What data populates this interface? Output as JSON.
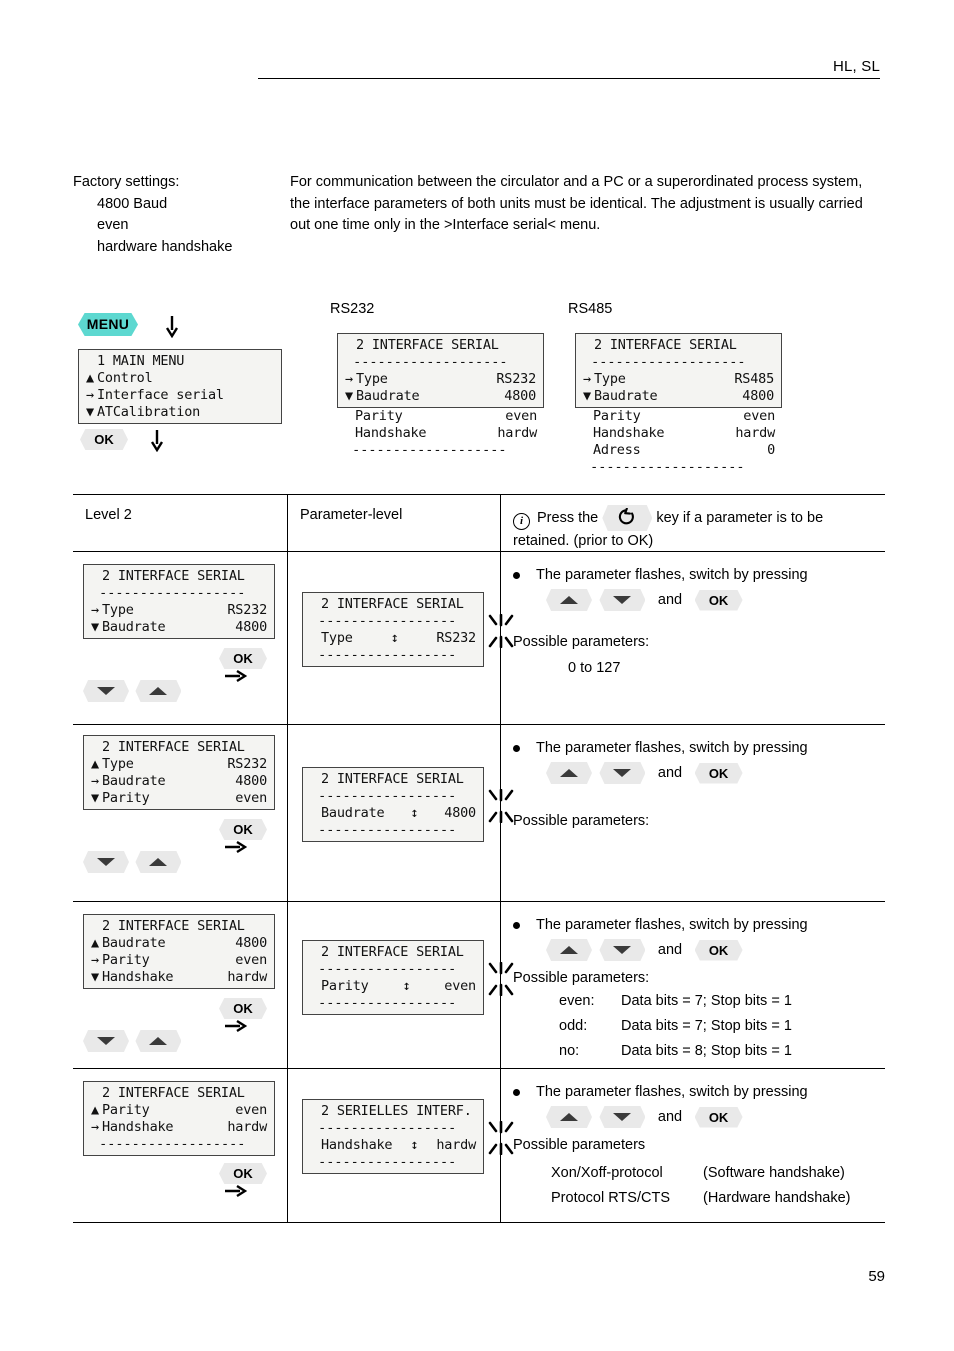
{
  "header": {
    "title": "HL, SL"
  },
  "page_number": "59",
  "intro": {
    "factory_label": "Factory settings:",
    "factory_items": [
      "4800 Baud",
      "even",
      "hardware handshake"
    ],
    "body": "For communication between the circulator and a PC or a superordinated process system, the interface parameters of both units must be identical. The adjustment is usually carried out one time only in the >Interface serial< menu."
  },
  "keys": {
    "menu": "MENU",
    "ok": "OK"
  },
  "flow": {
    "main_menu": {
      "title": "1 MAIN MENU",
      "lines": [
        {
          "marker": "up",
          "label": "Control",
          "value": ""
        },
        {
          "marker": "sel",
          "label": "Interface serial",
          "value": ""
        },
        {
          "marker": "down",
          "label": "ATCalibration",
          "value": ""
        }
      ]
    },
    "rs232_caption": "RS232",
    "rs485_caption": "RS485",
    "rs232_display": {
      "title": "2 INTERFACE SERIAL",
      "framed_lines": [
        {
          "marker": "sel",
          "label": "Type",
          "value": "RS232"
        },
        {
          "marker": "down",
          "label": "Baudrate",
          "value": "4800"
        }
      ],
      "tail_lines": [
        {
          "marker": "",
          "label": "Parity",
          "value": "even"
        },
        {
          "marker": "",
          "label": "Handshake",
          "value": "hardw"
        }
      ]
    },
    "rs485_display": {
      "title": "2 INTERFACE SERIAL",
      "framed_lines": [
        {
          "marker": "sel",
          "label": "Type",
          "value": "RS485"
        },
        {
          "marker": "down",
          "label": "Baudrate",
          "value": "4800"
        }
      ],
      "tail_lines": [
        {
          "marker": "",
          "label": "Parity",
          "value": "even"
        },
        {
          "marker": "",
          "label": "Handshake",
          "value": "hardw"
        },
        {
          "marker": "",
          "label": "Adress",
          "value": "0"
        }
      ]
    }
  },
  "table": {
    "headers": {
      "level": "Level 2",
      "parameter": "Parameter-level",
      "note_before": "Press the",
      "note_after": "key if a parameter is to be retained. (prior to OK)"
    },
    "rows": [
      {
        "level_display": {
          "title": "2 INTERFACE SERIAL",
          "has_separator": true,
          "lines": [
            {
              "marker": "sel",
              "label": "Type",
              "value": "RS232"
            },
            {
              "marker": "down",
              "label": "Baudrate",
              "value": "4800"
            }
          ]
        },
        "param_display": {
          "title": "2 INTERFACE SERIAL",
          "label": "Type",
          "value": "RS232"
        },
        "instruction": "The parameter flashes, switch by pressing",
        "and_label": "and",
        "possible_label": "Possible parameters:",
        "possible_values": [
          "0 to 127"
        ],
        "possible_pairs": []
      },
      {
        "level_display": {
          "title": "2 INTERFACE SERIAL",
          "has_separator": false,
          "lines": [
            {
              "marker": "up",
              "label": "Type",
              "value": "RS232"
            },
            {
              "marker": "sel",
              "label": "Baudrate",
              "value": "4800"
            },
            {
              "marker": "down",
              "label": "Parity",
              "value": "even"
            }
          ]
        },
        "param_display": {
          "title": "2 INTERFACE SERIAL",
          "label": "Baudrate",
          "value": "4800"
        },
        "instruction": "The parameter flashes, switch by pressing",
        "and_label": "and",
        "possible_label": "Possible parameters:",
        "possible_values": [],
        "possible_pairs": []
      },
      {
        "level_display": {
          "title": "2 INTERFACE SERIAL",
          "has_separator": false,
          "lines": [
            {
              "marker": "up",
              "label": "Baudrate",
              "value": "4800"
            },
            {
              "marker": "sel",
              "label": "Parity",
              "value": "even"
            },
            {
              "marker": "down",
              "label": "Handshake",
              "value": "hardw"
            }
          ]
        },
        "param_display": {
          "title": "2 INTERFACE SERIAL",
          "label": "Parity",
          "value": "even"
        },
        "instruction": "The parameter flashes, switch by pressing",
        "and_label": "and",
        "possible_label": "Possible parameters:",
        "possible_values": [],
        "possible_pairs": [
          {
            "key": "even:",
            "text": "Data bits = 7; Stop bits = 1"
          },
          {
            "key": "odd:",
            "text": "Data bits = 7; Stop bits = 1"
          },
          {
            "key": "no:",
            "text": "Data bits = 8; Stop bits = 1"
          }
        ]
      },
      {
        "level_display": {
          "title": "2 INTERFACE SERIAL",
          "has_separator": false,
          "has_bottom_dashes": true,
          "lines": [
            {
              "marker": "up",
              "label": "Parity",
              "value": "even"
            },
            {
              "marker": "sel",
              "label": "Handshake",
              "value": "hardw"
            }
          ]
        },
        "param_display": {
          "title": "2 SERIELLES INTERF.",
          "label": "Handshake",
          "value": "hardw"
        },
        "instruction": "The parameter flashes, switch by pressing",
        "and_label": "and",
        "possible_label": "Possible parameters",
        "possible_values": [],
        "possible_pairs": [
          {
            "key": "Xon/Xoff-protocol",
            "text": "(Software handshake)"
          },
          {
            "key": "Protocol RTS/CTS",
            "text": "(Hardware handshake)"
          }
        ]
      }
    ]
  },
  "colors": {
    "menu_badge": "#5dd8d0",
    "key_badge": "#e9e9e9",
    "lcd_bg": "#f4f4f2"
  }
}
